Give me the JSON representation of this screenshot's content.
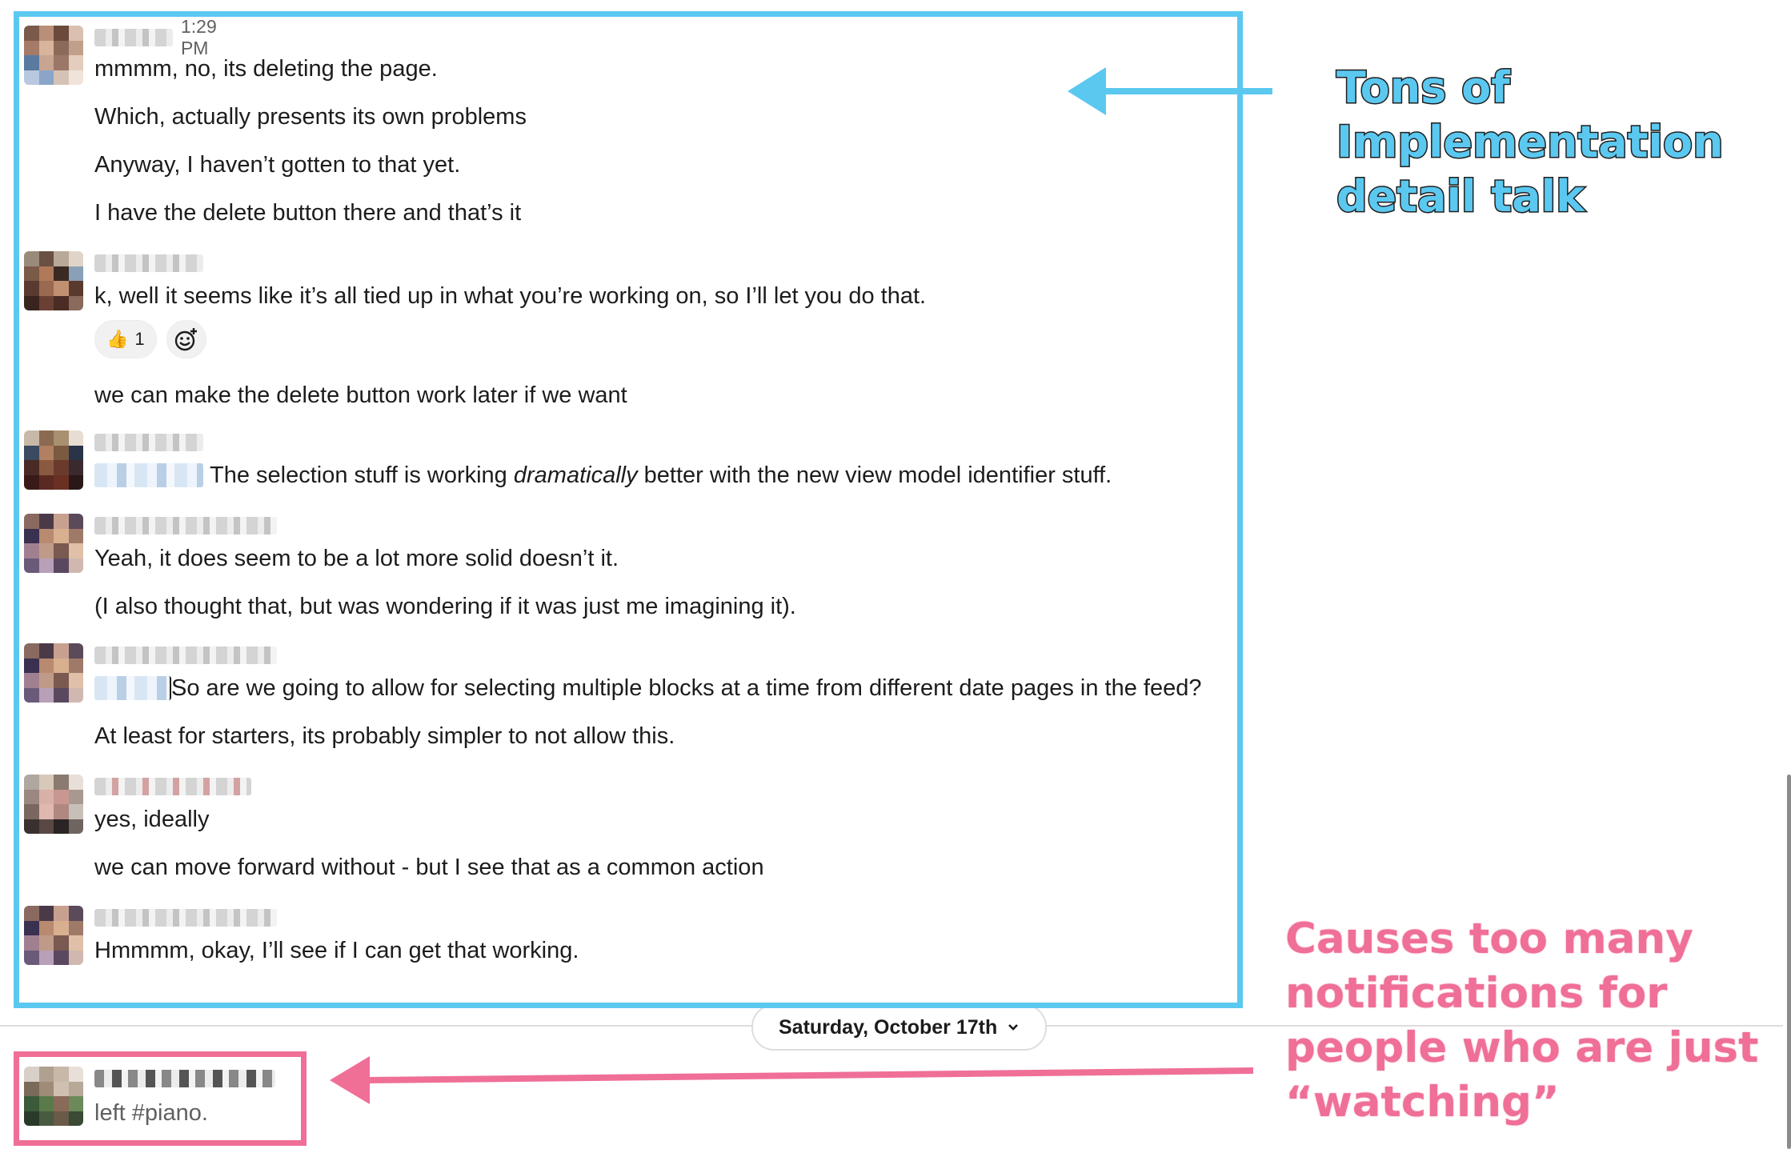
{
  "messages": [
    {
      "time": "1:29 PM",
      "lines": [
        "mmmm, no, its deleting the page.",
        "Which, actually presents its own problems",
        "Anyway, I haven’t gotten to that yet.",
        "I have the delete button there and that’s it"
      ]
    },
    {
      "lines": [
        "k, well it seems like it’s all tied up in what you’re working on, so I’ll let you do that."
      ],
      "reactions": [
        {
          "emoji": "👍",
          "count": "1"
        }
      ],
      "followup": "we can make the delete button work later if we want"
    },
    {
      "line_pre": "The selection stuff is working ",
      "line_em": "dramatically",
      "line_post": " better with the new view model identifier stuff."
    },
    {
      "lines": [
        "Yeah, it does seem to be a lot more solid doesn’t it.",
        "(I also thought that, but was wondering if it was just me imagining it)."
      ]
    },
    {
      "lines": [
        "So are we going to allow for selecting multiple blocks at a time from different date pages in the feed?",
        "At least for starters, its probably simpler to not allow this."
      ]
    },
    {
      "lines": [
        "yes, ideally",
        "we can move forward without - but I see that as a common action"
      ]
    },
    {
      "lines": [
        "Hmmmm, okay, I’ll see if I can get that working."
      ]
    }
  ],
  "date_divider": "Saturday, October 17th",
  "system_message": "left #piano.",
  "annotations": {
    "blue": "Tons of Implementation detail talk",
    "pink": "Causes too many notifications for people who are just “watching”"
  },
  "colors": {
    "blue": "#5bc8f0",
    "pink": "#ef6f97"
  },
  "icons": {
    "reaction_add": "add-reaction-icon",
    "chevron": "chevron-down-icon"
  }
}
